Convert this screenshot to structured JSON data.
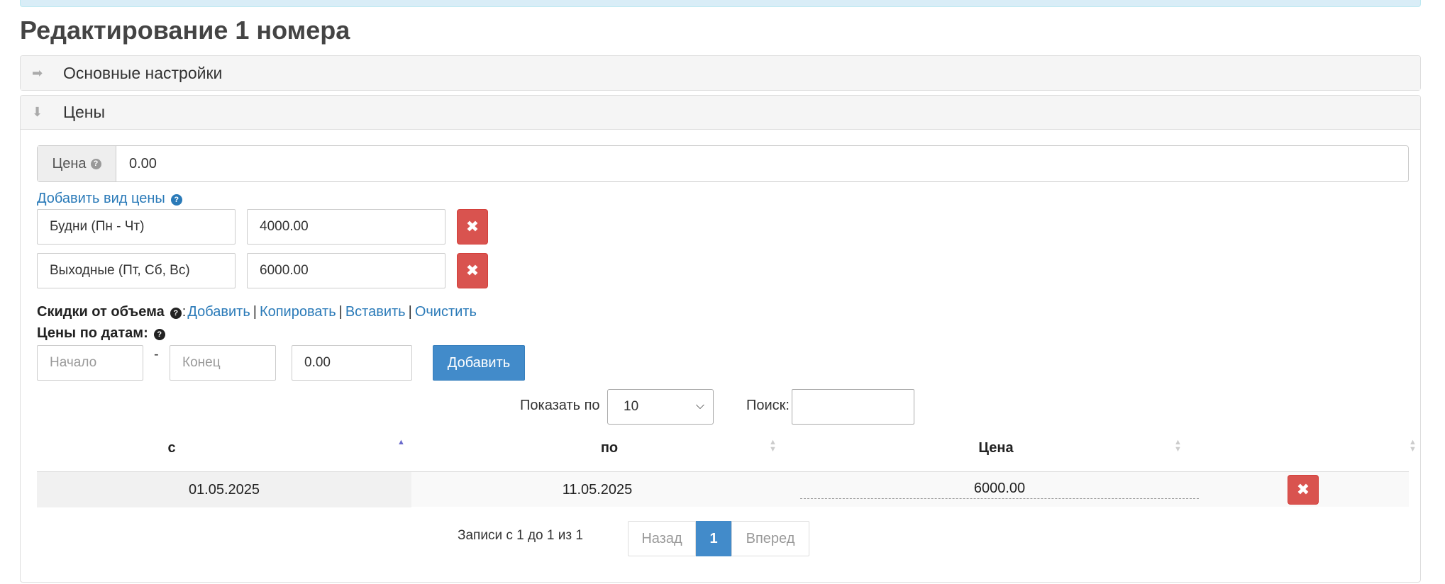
{
  "page": {
    "title": "Редактирование 1 номера"
  },
  "panels": {
    "main_settings": {
      "title": "Основные настройки"
    },
    "prices": {
      "title": "Цены"
    }
  },
  "icons": {
    "collapsed_arrow": "arrow-right-icon",
    "expanded_arrow": "arrow-down-icon",
    "help": "question-circle-icon",
    "remove": "times-icon"
  },
  "price": {
    "label": "Цена",
    "value": "0.00"
  },
  "add_price_type": {
    "label": "Добавить вид цены"
  },
  "price_types": [
    {
      "name": "Будни (Пн - Чт)",
      "value": "4000.00"
    },
    {
      "name": "Выходные (Пт, Сб, Вс)",
      "value": "6000.00"
    }
  ],
  "volume_discounts": {
    "label": "Скидки от объема",
    "colon": ":",
    "links": {
      "add": "Добавить",
      "copy": "Копировать",
      "paste": "Вставить",
      "clear": "Очистить"
    },
    "separator": "|"
  },
  "date_prices": {
    "label": "Цены по датам:",
    "start_placeholder": "Начало",
    "dash": "-",
    "end_placeholder": "Конец",
    "price_value": "0.00",
    "add_button": "Добавить"
  },
  "table_controls": {
    "show_label": "Показать по",
    "page_size": "10",
    "search_label": "Поиск:"
  },
  "table": {
    "columns": [
      "с",
      "по",
      "Цена",
      ""
    ],
    "rows": [
      {
        "from": "01.05.2025",
        "to": "11.05.2025",
        "price": "6000.00"
      }
    ]
  },
  "pagination": {
    "info": "Записи с 1 до 1 из 1",
    "prev": "Назад",
    "current": "1",
    "next": "Вперед"
  },
  "colors": {
    "primary": "#428bca",
    "danger": "#d9534f",
    "link": "#2a7ab8"
  }
}
